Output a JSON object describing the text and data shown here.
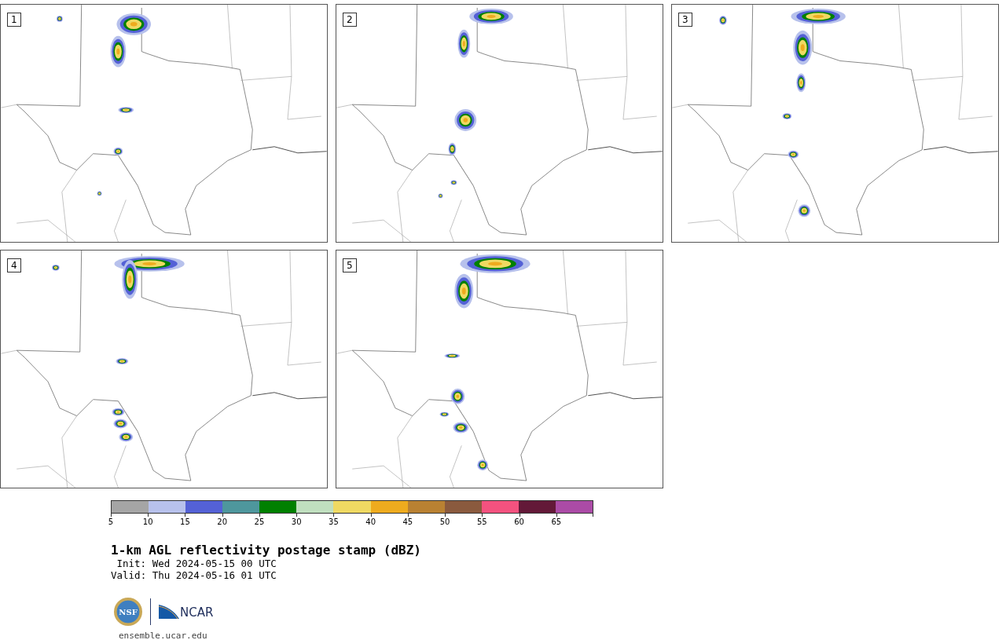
{
  "panels": [
    {
      "number": "1"
    },
    {
      "number": "2"
    },
    {
      "number": "3"
    },
    {
      "number": "4"
    },
    {
      "number": "5"
    }
  ],
  "colorbar": {
    "bins": [
      {
        "label": "5",
        "color": "#a5a5a5"
      },
      {
        "label": "10",
        "color": "#b7c1ec"
      },
      {
        "label": "15",
        "color": "#5461d6"
      },
      {
        "label": "20",
        "color": "#4e979d"
      },
      {
        "label": "25",
        "color": "#008000"
      },
      {
        "label": "30",
        "color": "#c0dfbf"
      },
      {
        "label": "35",
        "color": "#efd962"
      },
      {
        "label": "40",
        "color": "#eeab1e"
      },
      {
        "label": "45",
        "color": "#b98132"
      },
      {
        "label": "50",
        "color": "#8a5a3e"
      },
      {
        "label": "55",
        "color": "#f4527f"
      },
      {
        "label": "60",
        "color": "#631938"
      },
      {
        "label": "65",
        "color": "#ab4ba6"
      }
    ]
  },
  "title": "1-km AGL reflectivity postage stamp (dBZ)",
  "init": "Init: Wed 2024-05-15 00 UTC",
  "valid": "Valid: Thu 2024-05-16 01 UTC",
  "logos": {
    "nsf": "NSF",
    "ncar": "NCAR"
  },
  "footer": "ensemble.ucar.edu"
}
